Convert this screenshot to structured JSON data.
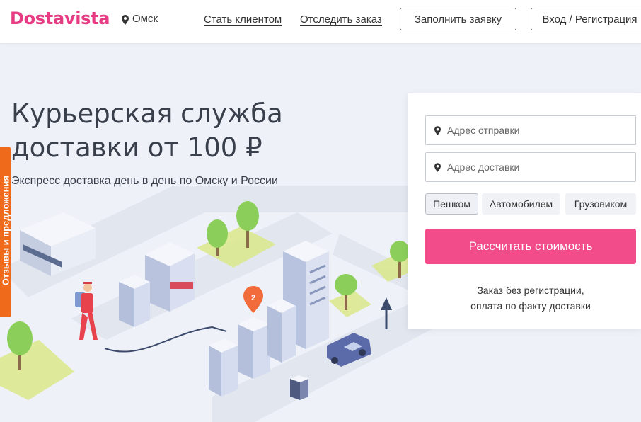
{
  "header": {
    "logo": "Dostavista",
    "city": "Омск",
    "nav": {
      "become_client": "Стать клиентом",
      "track_order": "Отследить заказ"
    },
    "fill_request": "Заполнить заявку",
    "login": "Вход / Регистрация"
  },
  "hero": {
    "title_line1": "Курьерская служба",
    "title_line2": "доставки от 100 ₽",
    "subtitle": "Экспресс доставка день в день по Омску и России"
  },
  "feedback_tab": "Отзывы и предложения",
  "form": {
    "from_placeholder": "Адрес отправки",
    "to_placeholder": "Адрес доставки",
    "modes": [
      "Пешком",
      "Автомобилем",
      "Грузовиком"
    ],
    "active_mode": "Пешком",
    "calc_button": "Рассчитать стоимость",
    "note_line1": "Заказ без регистрации,",
    "note_line2": "оплата по факту доставки"
  },
  "illustration": {
    "badge_number": "2"
  },
  "colors": {
    "brand": "#e63c83",
    "cta": "#f24c8a",
    "feedback": "#ef6a1a",
    "background": "#eef2f8"
  }
}
